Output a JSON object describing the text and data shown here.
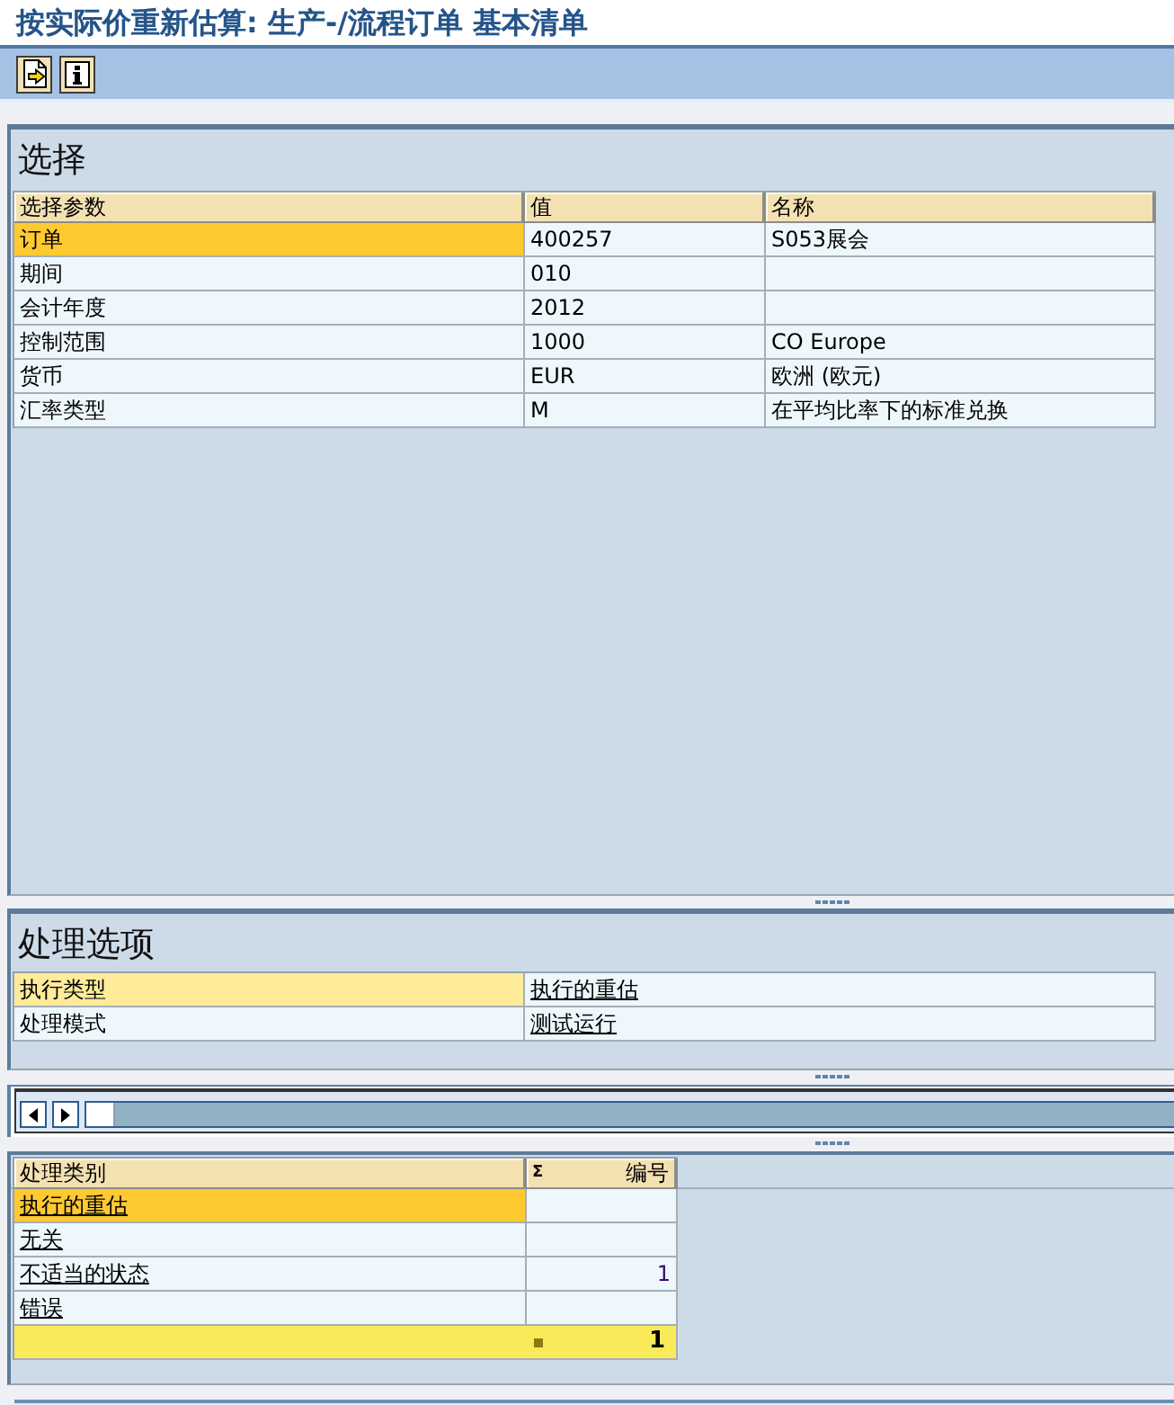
{
  "window": {
    "title": "按实际价重新估算: 生产-/流程订单 基本清单"
  },
  "selection": {
    "title": "选择",
    "columns": [
      "选择参数",
      "值",
      "名称"
    ],
    "rows": [
      {
        "parameter": "订单",
        "value": "400257",
        "name": "S053展会",
        "selected": true
      },
      {
        "parameter": "期间",
        "value": "010",
        "selected": false
      },
      {
        "parameter": "会计年度",
        "value": "2012",
        "selected": false
      },
      {
        "parameter": "控制范围",
        "value": "1000",
        "name": "CO Europe",
        "selected": false
      },
      {
        "parameter": "货币",
        "value": "EUR",
        "name": "欧洲 (欧元)",
        "selected": false
      },
      {
        "parameter": "汇率类型",
        "value": "M",
        "name": "在平均比率下的标准兑换",
        "selected": false
      }
    ]
  },
  "processing_options": {
    "title": "处理选项",
    "rows": [
      {
        "label": "执行类型",
        "value": "执行的重估",
        "selected": true
      },
      {
        "label": "处理模式",
        "value": "测试运行",
        "selected": false
      }
    ]
  },
  "results": {
    "columns": [
      {
        "label": "处理类别"
      },
      {
        "label": "编号",
        "sum_symbol": "Σ"
      }
    ],
    "rows": [
      {
        "category": "执行的重估",
        "selected": true
      },
      {
        "category": "无关",
        "selected": false
      },
      {
        "category": "不适当的状态",
        "count": "1",
        "selected": false
      },
      {
        "category": "错误",
        "selected": false
      }
    ],
    "total": "1"
  }
}
